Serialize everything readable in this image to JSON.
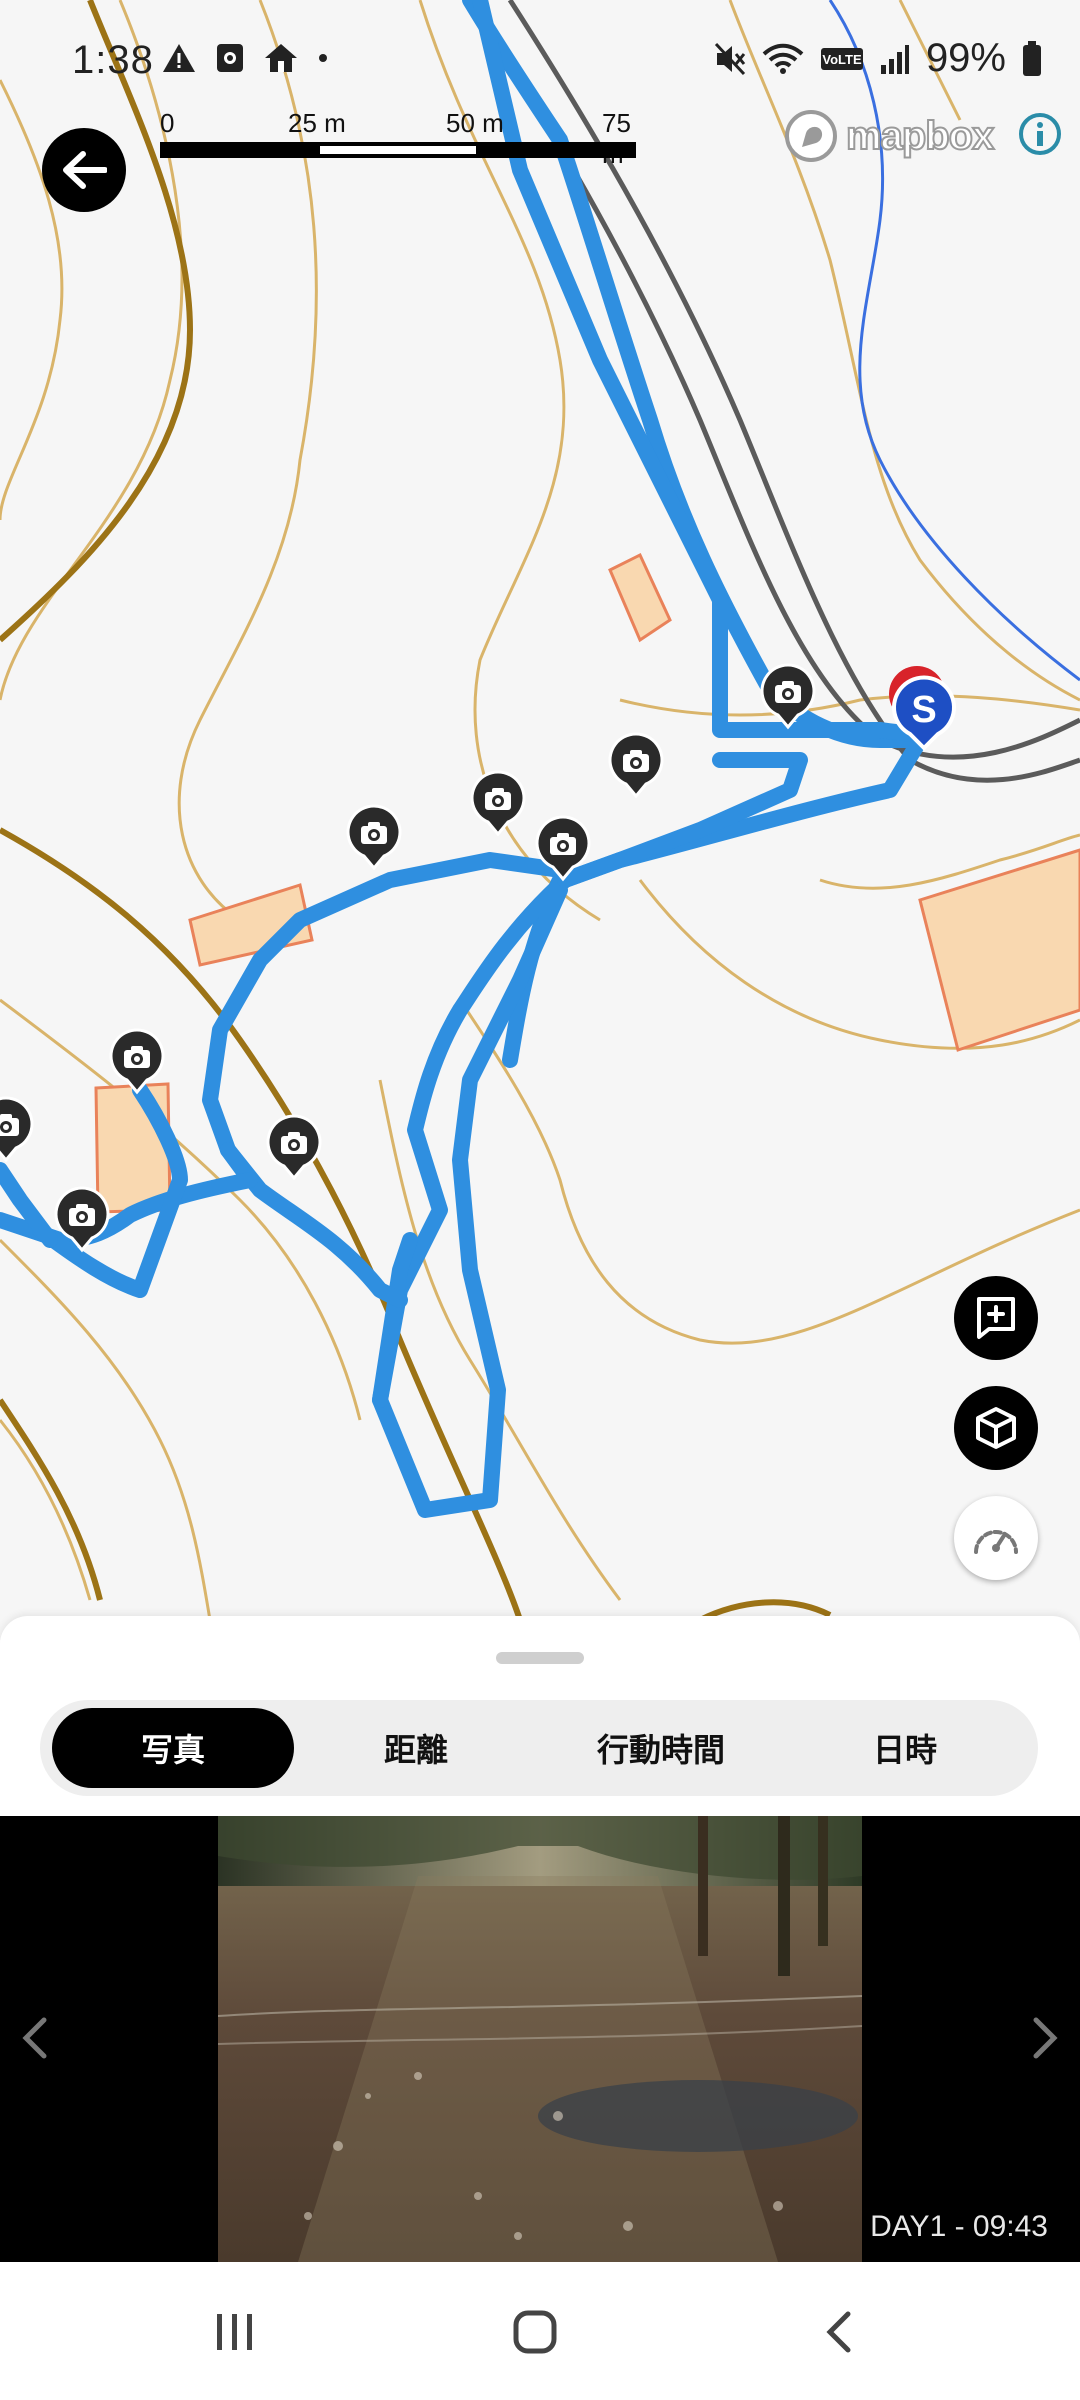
{
  "status_bar": {
    "time": "1:38",
    "battery_percent": "99%",
    "network_label": "VoLTE",
    "left_icons": [
      "warning-icon",
      "screen-record-icon",
      "home-icon",
      "dot-icon"
    ],
    "right_icons": [
      "mute-icon",
      "wifi-icon",
      "volte-icon",
      "signal-icon",
      "battery-icon"
    ]
  },
  "map": {
    "scale_labels": [
      "0",
      "25 m",
      "50 m",
      "75 m"
    ],
    "attribution": "mapbox",
    "start_marker_label": "S",
    "colors": {
      "route": "#2f8fe0",
      "contour": "#d9b46a",
      "contour_index": "#9c7316",
      "building_fill": "#f9d8b0",
      "building_stroke": "#e9825a",
      "road": "#5b5b5b",
      "stream": "#3a6fe0",
      "background": "#f6f6f6"
    },
    "photo_marker_count": 9,
    "controls": [
      "add-note-button",
      "3d-view-button",
      "speedometer-button"
    ]
  },
  "sheet": {
    "tabs": [
      {
        "label": "写真",
        "active": true
      },
      {
        "label": "距離",
        "active": false
      },
      {
        "label": "行動時間",
        "active": false
      },
      {
        "label": "日時",
        "active": false
      }
    ],
    "photo_caption": "DAY1 - 09:43"
  },
  "nav_bar": {
    "buttons": [
      "recent-apps-icon",
      "home-icon",
      "back-icon"
    ]
  }
}
